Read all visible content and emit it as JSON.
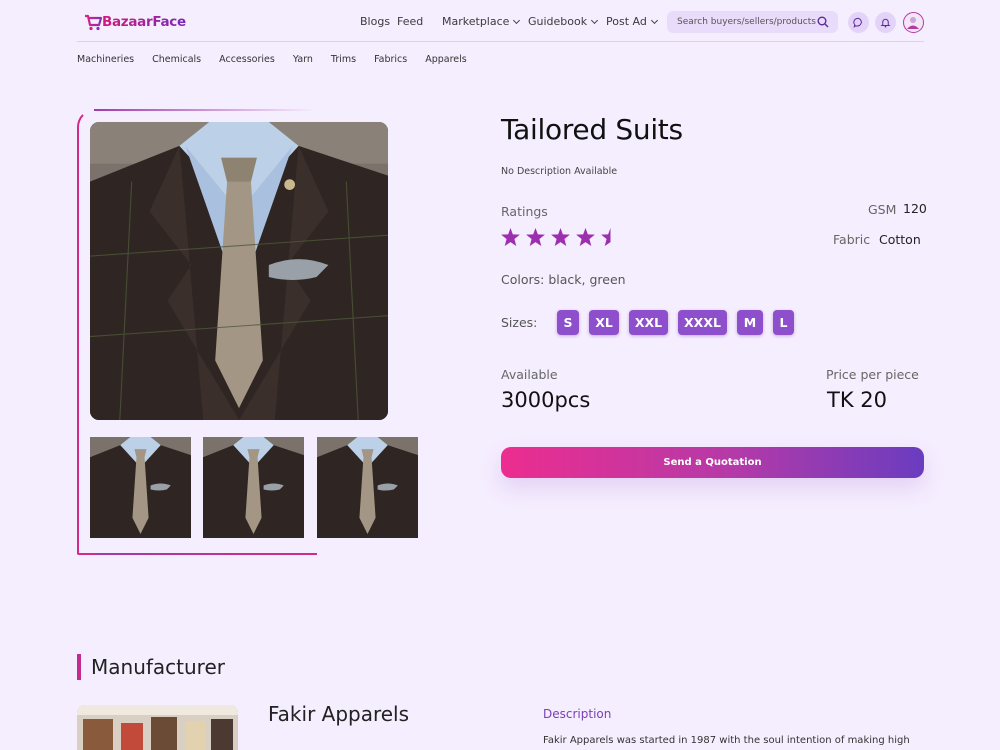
{
  "header": {
    "logo_text": "BazaarFace",
    "nav": {
      "blogs": "Blogs",
      "feed": "Feed",
      "marketplace": "Marketplace",
      "guidebook": "Guidebook",
      "post_ad": "Post Ad"
    },
    "search_placeholder": "Search buyers/sellers/products"
  },
  "categories": [
    "Machineries",
    "Chemicals",
    "Accessories",
    "Yarn",
    "Trims",
    "Fabrics",
    "Apparels"
  ],
  "product": {
    "title": "Tailored Suits",
    "description": "No Description Available",
    "ratings_label": "Ratings",
    "rating": 4.5,
    "gsm_label": "GSM",
    "gsm_value": "120",
    "fabric_label": "Fabric",
    "fabric_value": "Cotton",
    "colors_text": "Colors: black, green",
    "sizes_label": "Sizes:",
    "sizes": [
      "S",
      "XL",
      "XXL",
      "XXXL",
      "M",
      "L"
    ],
    "available_label": "Available",
    "available_value": "3000pcs",
    "price_label": "Price per piece",
    "price_value": "TK 20",
    "quote_button": "Send a Quotation"
  },
  "manufacturer": {
    "heading": "Manufacturer",
    "name": "Fakir Apparels",
    "description_heading": "Description",
    "description": "Fakir Apparels was started in 1987 with the soul intention of making high"
  },
  "colors": {
    "accent_purple": "#8d4fcb",
    "accent_pink": "#ec2d8f",
    "star": "#9b2fae",
    "background": "#f5eefe"
  }
}
